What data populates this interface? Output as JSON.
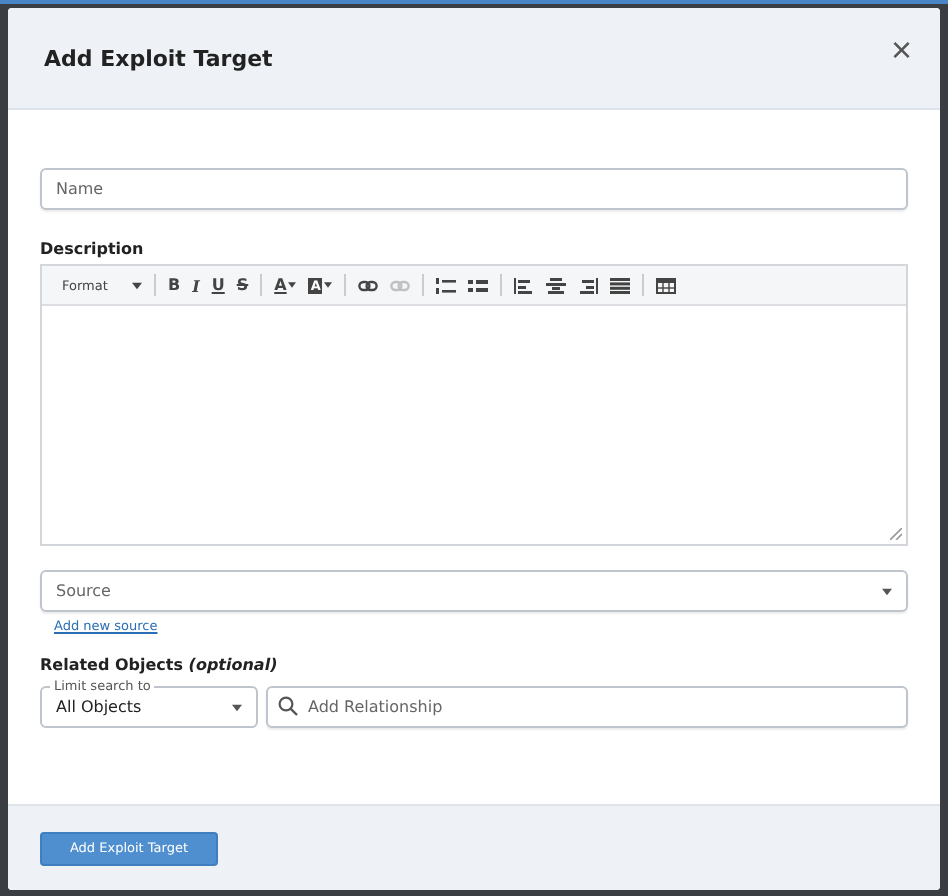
{
  "dialog": {
    "title": "Add Exploit Target",
    "close": "×"
  },
  "name_field": {
    "placeholder": "Name"
  },
  "description": {
    "label": "Description",
    "toolbar": [
      [
        {
          "kind": "dropdown",
          "label": "Format"
        }
      ],
      [
        {
          "kind": "letter",
          "label": "B"
        },
        {
          "kind": "letter",
          "label": "I"
        },
        {
          "kind": "letter",
          "label": "U"
        },
        {
          "kind": "letter",
          "label": "S"
        }
      ],
      [
        {
          "kind": "text-color",
          "label": "A"
        },
        {
          "kind": "highlight",
          "label": "A"
        }
      ],
      [
        {
          "kind": "link",
          "disabled": false
        },
        {
          "kind": "unlink",
          "disabled": true
        }
      ],
      [
        {
          "kind": "ordered-list",
          "disabled": false
        },
        {
          "kind": "bullet-list",
          "disabled": false
        }
      ],
      [
        {
          "kind": "align-left",
          "disabled": false
        },
        {
          "kind": "align-center",
          "disabled": false
        },
        {
          "kind": "align-right",
          "disabled": false
        },
        {
          "kind": "justify",
          "disabled": false
        }
      ],
      [
        {
          "kind": "table",
          "disabled": false
        }
      ]
    ]
  },
  "source": {
    "placeholder": "Source",
    "link": "Add new source"
  },
  "related": {
    "label": "Related Objects *(optional)*",
    "scope_label": "Limit search to",
    "scope_value": "All Objects",
    "search_placeholder": "Add Relationship"
  },
  "footer": {
    "button": "Add Exploit Target"
  }
}
